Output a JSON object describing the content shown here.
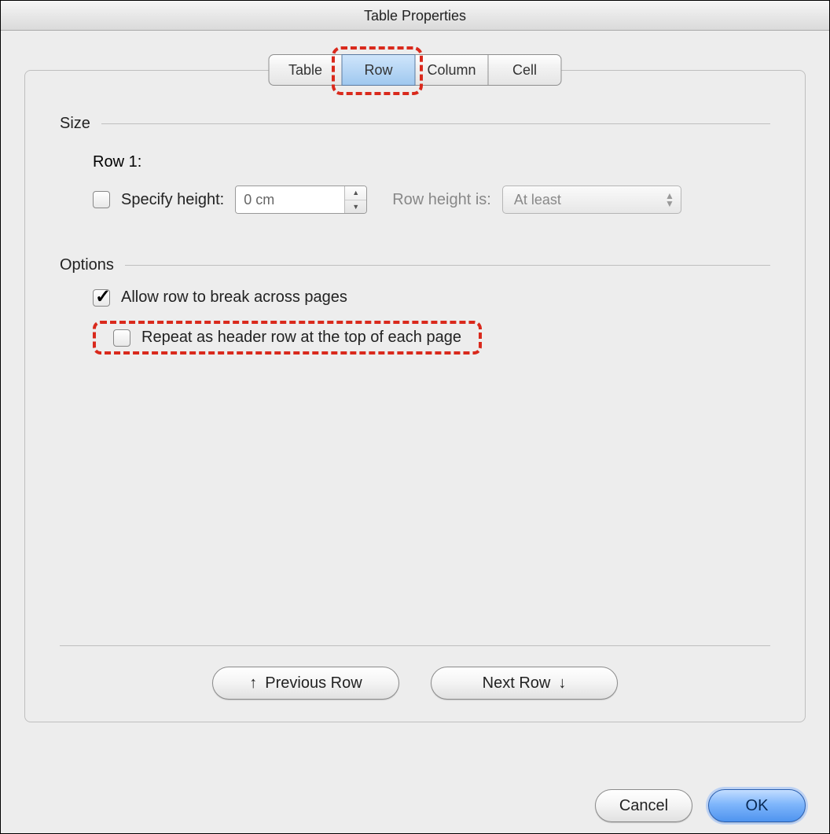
{
  "window": {
    "title": "Table Properties"
  },
  "tabs": {
    "table": "Table",
    "row": "Row",
    "column": "Column",
    "cell": "Cell",
    "selected": "row"
  },
  "size": {
    "section_label": "Size",
    "row_label": "Row 1:",
    "specify_height_label": "Specify height:",
    "specify_height_checked": false,
    "height_value": "0 cm",
    "row_height_is_label": "Row height is:",
    "row_height_mode": "At least"
  },
  "options": {
    "section_label": "Options",
    "allow_break_label": "Allow row to break across pages",
    "allow_break_checked": true,
    "repeat_header_label": "Repeat as header row at the top of each page",
    "repeat_header_checked": false
  },
  "nav": {
    "prev": "Previous Row",
    "next": "Next Row"
  },
  "footer": {
    "cancel": "Cancel",
    "ok": "OK"
  }
}
